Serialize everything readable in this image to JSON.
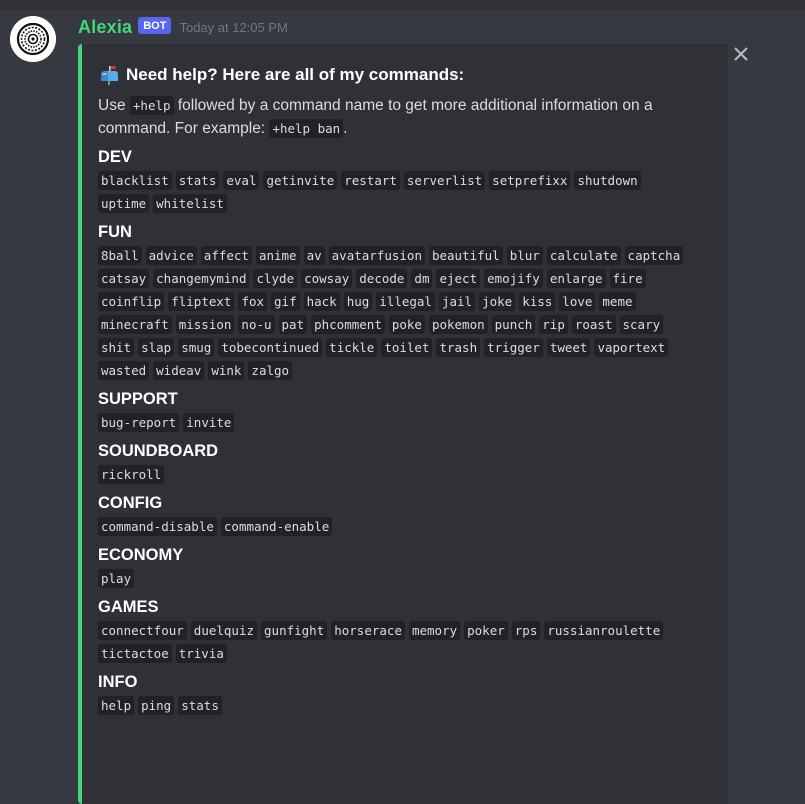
{
  "message": {
    "author": "Alexia",
    "bot_tag": "BOT",
    "timestamp": "Today at 12:05 PM",
    "colors": {
      "accent": "#43d67b",
      "bot_tag": "#5865f2",
      "background": "#36393f",
      "embed_background": "#2f3136",
      "code_background": "#202225"
    }
  },
  "embed": {
    "icon": "mailbox-icon",
    "title": "Need help? Here are all of my commands:",
    "desc_1": "Use",
    "desc_code_1": "+help",
    "desc_2": "followed by a command name to get more additional information on a command. For example:",
    "desc_code_2": "+help ban",
    "desc_3": ".",
    "close_icon": "close-icon"
  },
  "sections": [
    {
      "name": "DEV",
      "commands": [
        "blacklist",
        "stats",
        "eval",
        "getinvite",
        "restart",
        "serverlist",
        "setprefixx",
        "shutdown",
        "uptime",
        "whitelist"
      ]
    },
    {
      "name": "FUN",
      "commands": [
        "8ball",
        "advice",
        "affect",
        "anime",
        "av",
        "avatarfusion",
        "beautiful",
        "blur",
        "calculate",
        "captcha",
        "catsay",
        "changemymind",
        "clyde",
        "cowsay",
        "decode",
        "dm",
        "eject",
        "emojify",
        "enlarge",
        "fire",
        "coinflip",
        "fliptext",
        "fox",
        "gif",
        "hack",
        "hug",
        "illegal",
        "jail",
        "joke",
        "kiss",
        "love",
        "meme",
        "minecraft",
        "mission",
        "no-u",
        "pat",
        "phcomment",
        "poke",
        "pokemon",
        "punch",
        "rip",
        "roast",
        "scary",
        "shit",
        "slap",
        "smug",
        "tobecontinued",
        "tickle",
        "toilet",
        "trash",
        "trigger",
        "tweet",
        "vaportext",
        "wasted",
        "wideav",
        "wink",
        "zalgo"
      ]
    },
    {
      "name": "SUPPORT",
      "commands": [
        "bug-report",
        "invite"
      ]
    },
    {
      "name": "SOUNDBOARD",
      "commands": [
        "rickroll"
      ]
    },
    {
      "name": "CONFIG",
      "commands": [
        "command-disable",
        "command-enable"
      ]
    },
    {
      "name": "ECONOMY",
      "commands": [
        "play"
      ]
    },
    {
      "name": "GAMES",
      "commands": [
        "connectfour",
        "duelquiz",
        "gunfight",
        "horserace",
        "memory",
        "poker",
        "rps",
        "russianroulette",
        "tictactoe",
        "trivia"
      ]
    },
    {
      "name": "INFO",
      "commands": [
        "help",
        "ping",
        "stats"
      ]
    }
  ]
}
